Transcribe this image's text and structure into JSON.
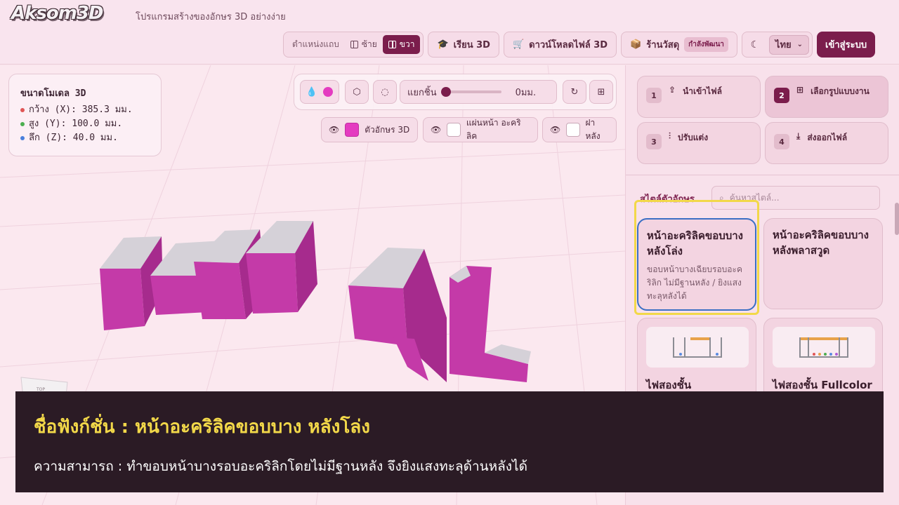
{
  "app": {
    "logo": "Aksom3D",
    "tagline": "โปรแกรมสร้างของอักษร 3D อย่างง่าย"
  },
  "header": {
    "position": {
      "label": "ตำแหน่งแถบ",
      "left": "ซ้าย",
      "right": "ขวา",
      "selected": "right"
    },
    "learn": "เรียน 3D",
    "download": "ดาวน์โหลดไฟล์ 3D",
    "shop": "ร้านวัสดุ",
    "shop_badge": "กำลังพัฒนา",
    "language": "ไทย",
    "login": "เข้าสู่ระบบ"
  },
  "viewport": {
    "dimensions": {
      "title": "ขนาดโมเดล 3D",
      "width": "กว้าง (X): 385.3 มม.",
      "height": "สูง (Y): 100.0 มม.",
      "depth": "ลึก (Z): 40.0 มม."
    },
    "separate_label": "แยกชิ้น",
    "separate_value": "0มม.",
    "layers": {
      "text3d": "ตัวอักษร 3D",
      "acrylic": "แผ่นหน้า อะคริลิค",
      "back": "ฝาหลัง"
    },
    "model_text": "หน้า AL",
    "colors": {
      "text_side": "#c43aa8",
      "text_face": "#cfcbd2",
      "accent": "#7b1d4c"
    }
  },
  "panel": {
    "steps": [
      {
        "num": "1",
        "label": "นำเข้าไฟล์"
      },
      {
        "num": "2",
        "label": "เลือกรูปแบบงาน"
      },
      {
        "num": "3",
        "label": "ปรับแต่ง"
      },
      {
        "num": "4",
        "label": "ส่งออกไฟล์"
      }
    ],
    "active_step": "2",
    "style_label": "สไตล์ตัวอักษร",
    "search_placeholder": "ค้นหาสไตล์...",
    "cards": [
      {
        "title": "หน้าอะคริลิคขอบบาง หลังโล่ง",
        "desc": "ขอบหน้าบางเฉียบรอบอะคริลิก ไม่มีฐานหลัง / ยิงแสงทะลุหลังได้",
        "selected": true
      },
      {
        "title": "หน้าอะคริลิคขอบบาง หลังพลาสวูด",
        "desc": "",
        "selected": false
      },
      {
        "title": "ไฟสองชั้น",
        "desc": ""
      },
      {
        "title": "ไฟสองชั้น Fullcolor",
        "desc": ""
      }
    ]
  },
  "caption": {
    "title": "ชื่อฟังก์ชั่น : หน้าอะคริลิคขอบบาง หลังโล่ง",
    "desc": "ความสามารถ : ทำขอบหน้าบางรอบอะคริลิกโดยไม่มีฐานหลัง จึงยิงแสงทะลุด้านหลังได้"
  }
}
